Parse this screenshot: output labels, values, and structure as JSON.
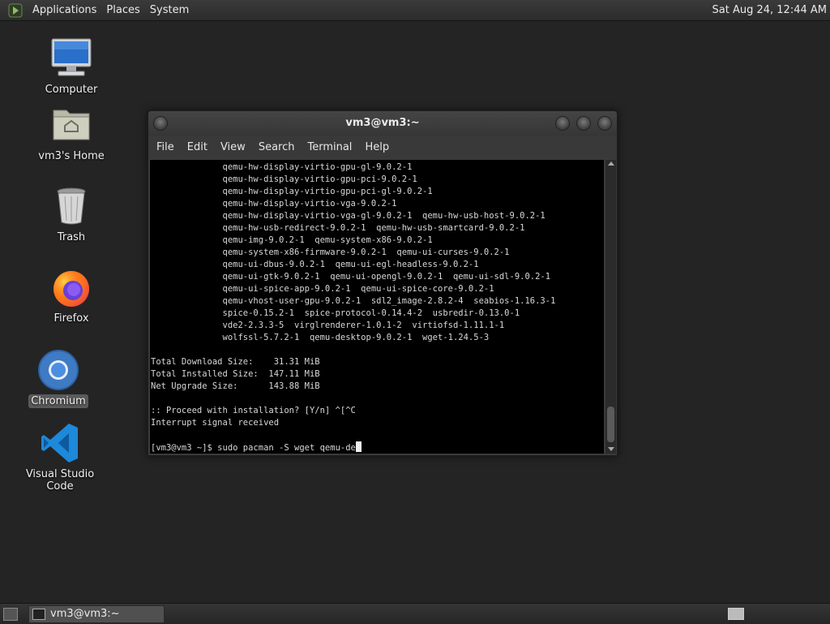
{
  "top_panel": {
    "menus": [
      "Applications",
      "Places",
      "System"
    ],
    "clock": "Sat Aug 24, 12:44 AM"
  },
  "desktop": {
    "icons": [
      {
        "label": "Computer"
      },
      {
        "label": "vm3's Home"
      },
      {
        "label": "Trash"
      },
      {
        "label": "Firefox"
      },
      {
        "label": "Chromium"
      },
      {
        "label": "Visual Studio Code"
      }
    ]
  },
  "terminal": {
    "title": "vm3@vm3:~",
    "menus": [
      "File",
      "Edit",
      "View",
      "Search",
      "Terminal",
      "Help"
    ],
    "lines": [
      "              qemu-hw-display-virtio-gpu-gl-9.0.2-1",
      "              qemu-hw-display-virtio-gpu-pci-9.0.2-1",
      "              qemu-hw-display-virtio-gpu-pci-gl-9.0.2-1",
      "              qemu-hw-display-virtio-vga-9.0.2-1",
      "              qemu-hw-display-virtio-vga-gl-9.0.2-1  qemu-hw-usb-host-9.0.2-1",
      "              qemu-hw-usb-redirect-9.0.2-1  qemu-hw-usb-smartcard-9.0.2-1",
      "              qemu-img-9.0.2-1  qemu-system-x86-9.0.2-1",
      "              qemu-system-x86-firmware-9.0.2-1  qemu-ui-curses-9.0.2-1",
      "              qemu-ui-dbus-9.0.2-1  qemu-ui-egl-headless-9.0.2-1",
      "              qemu-ui-gtk-9.0.2-1  qemu-ui-opengl-9.0.2-1  qemu-ui-sdl-9.0.2-1",
      "              qemu-ui-spice-app-9.0.2-1  qemu-ui-spice-core-9.0.2-1",
      "              qemu-vhost-user-gpu-9.0.2-1  sdl2_image-2.8.2-4  seabios-1.16.3-1",
      "              spice-0.15.2-1  spice-protocol-0.14.4-2  usbredir-0.13.0-1",
      "              vde2-2.3.3-5  virglrenderer-1.0.1-2  virtiofsd-1.11.1-1",
      "              wolfssl-5.7.2-1  qemu-desktop-9.0.2-1  wget-1.24.5-3",
      "",
      "Total Download Size:    31.31 MiB",
      "Total Installed Size:  147.11 MiB",
      "Net Upgrade Size:      143.88 MiB",
      "",
      ":: Proceed with installation? [Y/n] ^[^C",
      "Interrupt signal received",
      ""
    ],
    "prompt": "[vm3@vm3 ~]$ sudo pacman -S wget qemu-de"
  },
  "taskbar": {
    "task_label": "vm3@vm3:~"
  },
  "colors": {
    "desktop_bg": "#242424",
    "terminal_bg": "#000000",
    "panel_bg": "#2c2c2c",
    "vscode_blue": "#1e88d9",
    "firefox_orange": "#ff7a1a",
    "chromium_blue": "#3f7ac4"
  },
  "icons": [
    "menu-logo-icon",
    "computer-icon",
    "home-folder-icon",
    "trash-icon",
    "firefox-icon",
    "chromium-icon",
    "vscode-icon",
    "terminal-icon",
    "show-desktop-icon",
    "workspace-icon"
  ]
}
